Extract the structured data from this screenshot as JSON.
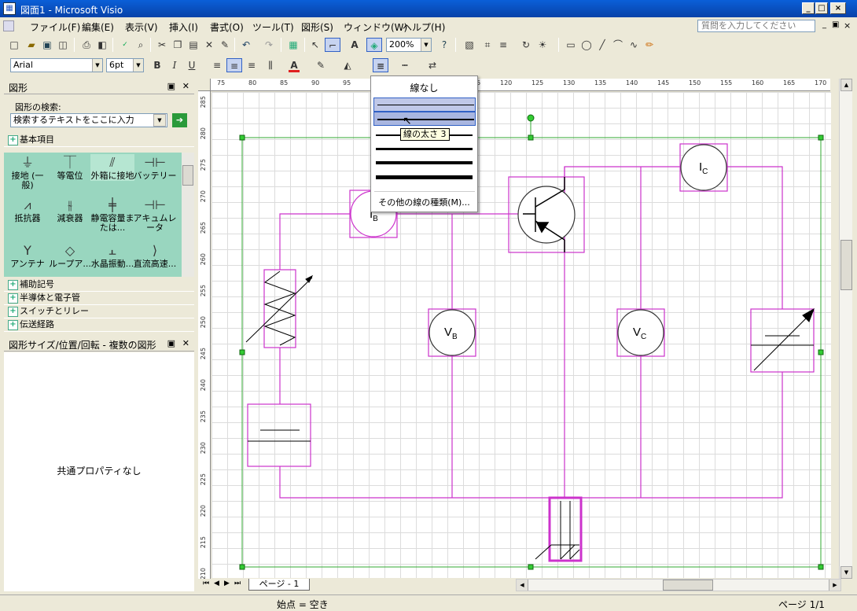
{
  "window": {
    "title": "図面1 - Microsoft Visio"
  },
  "menu": {
    "items": [
      "ファイル(F)",
      "編集(E)",
      "表示(V)",
      "挿入(I)",
      "書式(O)",
      "ツール(T)",
      "図形(S)",
      "ウィンドウ(W)",
      "ヘルプ(H)"
    ],
    "help_placeholder": "質問を入力してください"
  },
  "toolbar": {
    "zoom": "200%",
    "font": "Arial",
    "font_size": "6pt",
    "bold": "B",
    "italic": "I",
    "underline": "U",
    "text_color": "A",
    "text_color_indicator": "#e02020"
  },
  "shapes_panel": {
    "title": "図形",
    "search_label": "図形の検索:",
    "search_placeholder": "検索するテキストをここに入力",
    "current_stencil": "基本項目",
    "items": [
      "接地 (一般)",
      "等電位",
      "外箱に接地",
      "バッテリー",
      "抵抗器",
      "減衰器",
      "静電容量または...",
      "アキュムレータ",
      "アンテナ",
      "ループア...",
      "水晶振動...",
      "直流高速..."
    ],
    "groups": [
      "補助記号",
      "半導体と電子管",
      "スイッチとリレー",
      "伝送経路"
    ]
  },
  "size_panel": {
    "title": "図形サイズ/位置/回転 - 複数の図形",
    "empty_text": "共通プロパティなし"
  },
  "ruler": {
    "h_labels": [
      "75",
      "80",
      "85",
      "90",
      "95",
      "100",
      "105",
      "110",
      "115",
      "120",
      "125",
      "130",
      "135",
      "140",
      "145",
      "150",
      "155",
      "160",
      "165",
      "170"
    ],
    "v_labels": [
      "285",
      "280",
      "275",
      "270",
      "265",
      "260",
      "255",
      "250",
      "245",
      "240",
      "235",
      "230",
      "225",
      "220",
      "215",
      "210"
    ]
  },
  "canvas_labels": {
    "ib": "I",
    "ib_sub": "B",
    "vb": "V",
    "vb_sub": "B",
    "vc": "V",
    "vc_sub": "C",
    "ic": "I",
    "ic_sub": "C"
  },
  "line_weight_menu": {
    "none_label": "線なし",
    "more_label": "その他の線の種類(M)...",
    "tooltip": "線の太さ 3",
    "weights": [
      1,
      2,
      3,
      4,
      5,
      6
    ]
  },
  "page_tab": "ページ - 1",
  "status": {
    "connection": "始点 = 空き",
    "page": "ページ 1/1"
  },
  "colors": {
    "shape": "#cc33cc",
    "selection": "#33aa33",
    "stencil_bg": "#99d6bf",
    "title_bar": "#0a5fd8"
  }
}
